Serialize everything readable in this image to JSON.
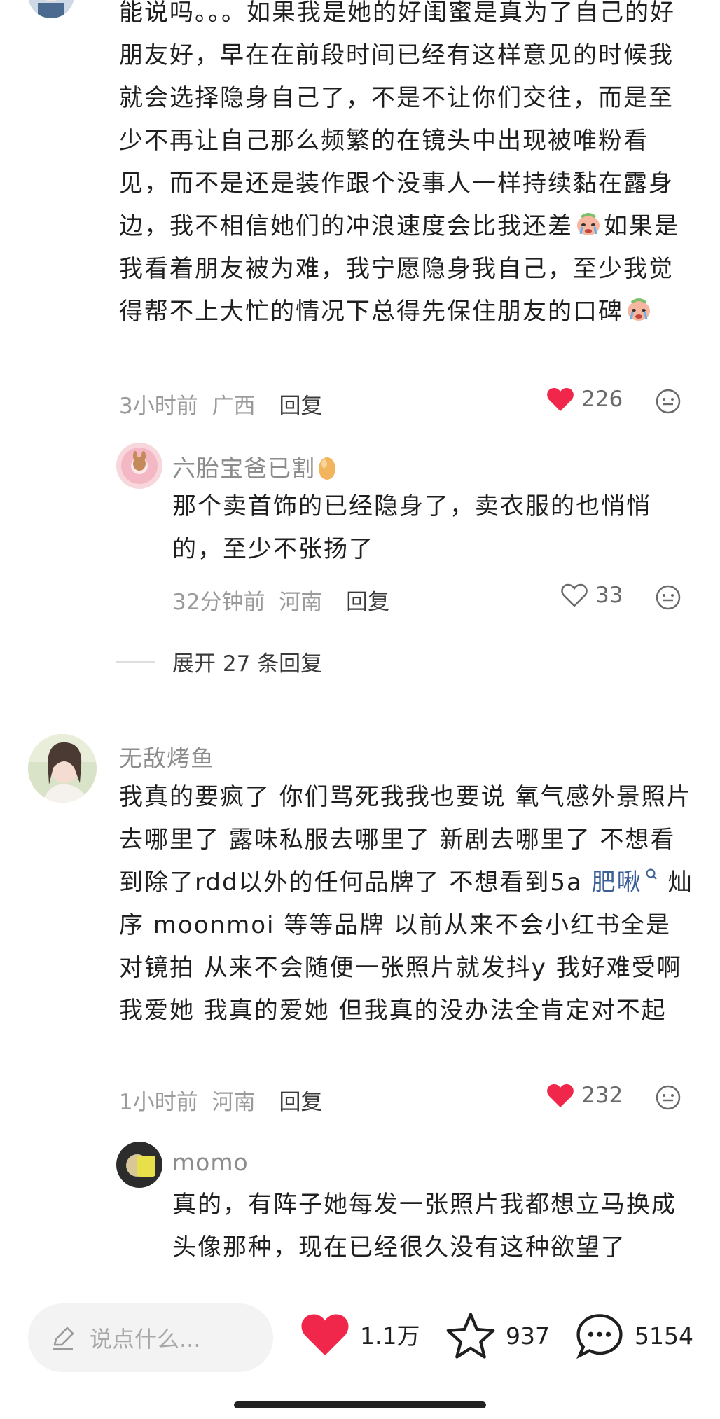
{
  "comment1": {
    "text": "能说吗。。。如果我是她的好闺蜜是真为了自己的好朋友好，早在在前段时间已经有这样意见的时候我就会选择隐身自己了，不是不让你们交往，而是至少不再让自己那么频繁的在镜头中出现被唯粉看见，而不是还是装作跟个没事人一样持续黏在露身边，我不相信她们的冲浪速度会比我还差",
    "text_after_emoji1": "如果是我看着朋友被为难，我宁愿隐身我自己，至少我觉得帮不上大忙的情况下总得先保住朋友的口碑",
    "time": "3小时前",
    "location": "广西",
    "reply_label": "回复",
    "likes": "226",
    "liked": true
  },
  "reply1": {
    "username": "六胎宝爸已割",
    "text": "那个卖首饰的已经隐身了，卖衣服的也悄悄的，至少不张扬了",
    "time": "32分钟前",
    "location": "河南",
    "reply_label": "回复",
    "likes": "33",
    "liked": false
  },
  "expand_replies": "展开 27 条回复",
  "comment2": {
    "username": "无敌烤鱼",
    "text_before_link": "我真的要疯了 你们骂死我我也要说 氧气感外景照片去哪里了 露味私服去哪里了 新剧去哪里了 不想看到除了rdd以外的任何品牌了 不想看到5a ",
    "link": "肥啾",
    "text_after_link": " 灿序 moonmoi 等等品牌 以前从来不会小红书全是对镜拍 从来不会随便一张照片就发抖y 我好难受啊 我爱她 我真的爱她 但我真的没办法全肯定对不起",
    "time": "1小时前",
    "location": "河南",
    "reply_label": "回复",
    "likes": "232",
    "liked": true
  },
  "reply2": {
    "username": "momo",
    "text": "真的，有阵子她每发一张照片我都想立马换成头像那种，现在已经很久没有这种欲望了"
  },
  "bottom_bar": {
    "input_placeholder": "说点什么...",
    "likes": "1.1万",
    "stars": "937",
    "comments": "5154"
  },
  "colors": {
    "heart_red": "#f0264b",
    "link_blue": "#3b5f96",
    "meta_gray": "#9a9a9a"
  }
}
